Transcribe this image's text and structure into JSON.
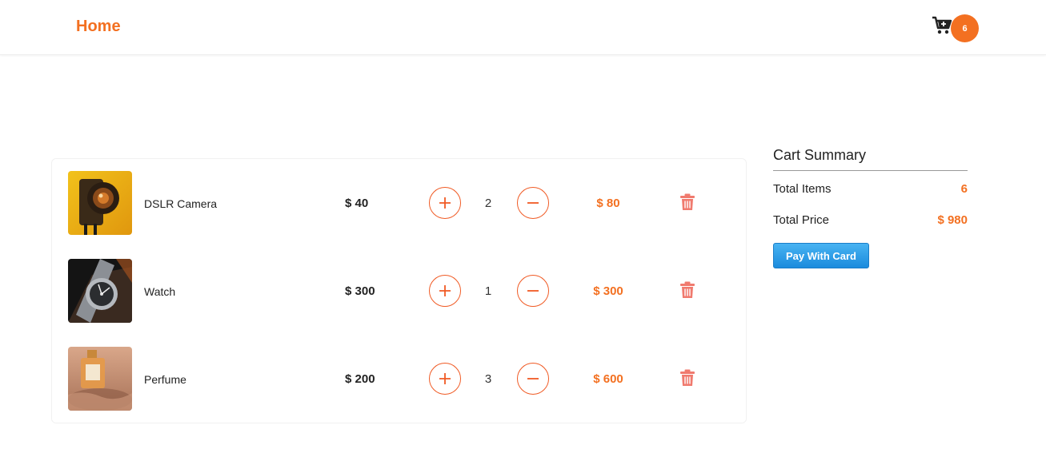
{
  "nav": {
    "brand": "Home",
    "cart_count": "6",
    "cart_icon": "cart-plus-icon"
  },
  "items": [
    {
      "name": "DSLR Camera",
      "price": "$ 40",
      "qty": "2",
      "total": "$ 80"
    },
    {
      "name": "Watch",
      "price": "$ 300",
      "qty": "1",
      "total": "$ 300"
    },
    {
      "name": "Perfume",
      "price": "$ 200",
      "qty": "3",
      "total": "$ 600"
    }
  ],
  "summary": {
    "title": "Cart Summary",
    "total_items_label": "Total Items",
    "total_items_value": "6",
    "total_price_label": "Total Price",
    "total_price_value": "$ 980",
    "pay_label": "Pay With Card"
  },
  "colors": {
    "accent": "#f37021",
    "button_border": "#f05a24",
    "trash": "#f07a6e",
    "pay_button": "#1b8bdd"
  }
}
